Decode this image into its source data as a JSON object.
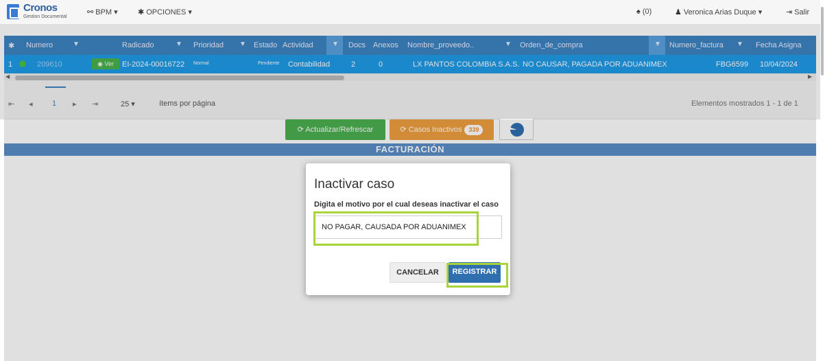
{
  "app": {
    "name": "Cronos",
    "subtitle": "Gestion Documental",
    "menu_bpm": "BPM ▾",
    "menu_options": "OPCIONES ▾",
    "notifications": "(0)",
    "user": "Veronica Arias Duque ▾",
    "logout": "Salir"
  },
  "grid": {
    "columns": [
      "Numero",
      "Radicado",
      "Prioridad",
      "Estado",
      "Actividad",
      "Docs",
      "Anexos",
      "Nombre_proveedo..",
      "Orden_de_compra",
      "Numero_factura",
      "Fecha Asigna"
    ],
    "row": {
      "index": "1",
      "numero": "209610",
      "ver": "Ver",
      "radicado": "EI-2024-00016722",
      "prioridad": "Normal",
      "estado": "Pendiente",
      "actividad": "Contabilidad",
      "docs": "2",
      "anexos": "0",
      "proveedor": "LX PANTOS COLOMBIA S.A.S.",
      "orden_compra": "NO CAUSAR, PAGADA POR ADUANIMEX",
      "numero_factura": "FBG6599",
      "fecha": "10/04/2024"
    }
  },
  "pager": {
    "current_page": "1",
    "page_size": "25",
    "items_label": "ítems por página",
    "summary": "Elementos mostrados 1 - 1 de 1"
  },
  "actions": {
    "refresh": "Actualizar/Refrescar",
    "inactive_cases": "Casos Inactivos",
    "inactive_count": "339"
  },
  "section_title": "FACTURACIÓN",
  "modal": {
    "title": "Inactivar caso",
    "label": "Digita el motivo por el cual deseas inactivar el caso",
    "input_value": "NO PAGAR, CAUSADA POR ADUANIMEX",
    "cancel": "CANCELAR",
    "register": "REGISTRAR"
  },
  "colors": {
    "header_blue": "#3c84c2",
    "row_blue": "#1e9be8",
    "highlight_green": "#a8d43a",
    "register_blue": "#2f6fb0"
  }
}
